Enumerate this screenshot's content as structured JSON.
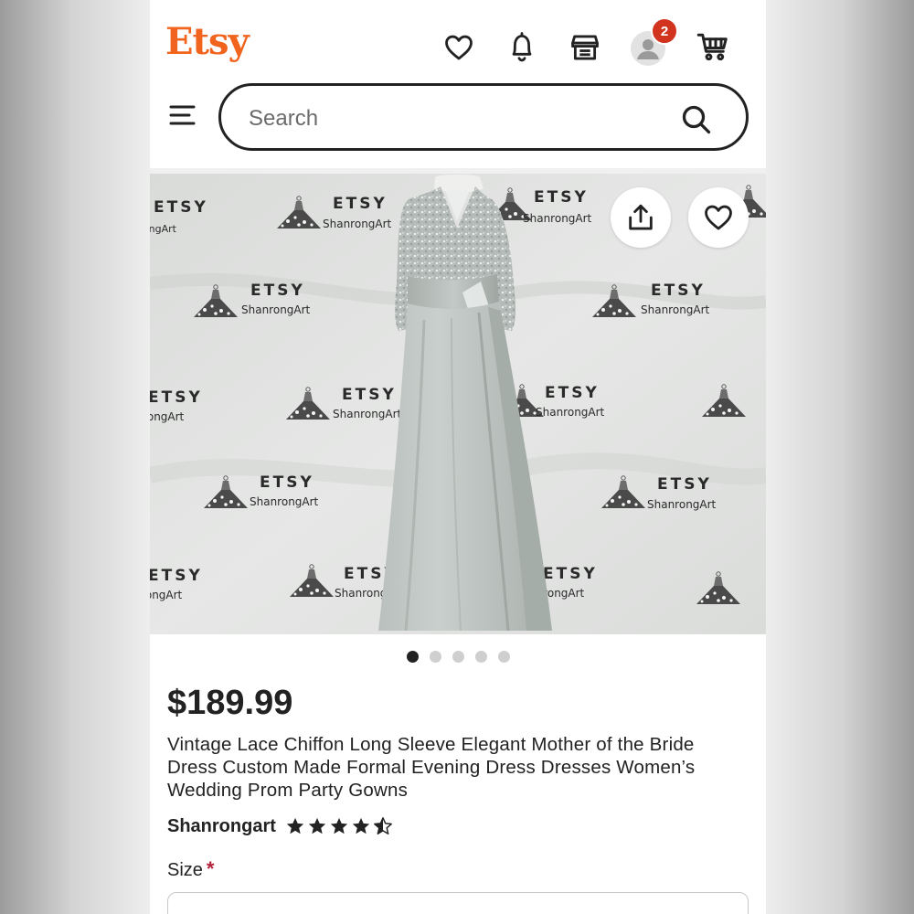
{
  "header": {
    "logo": "Etsy",
    "notification_badge": "2",
    "accent": "#f1641e",
    "badge_color": "#d2331e",
    "icons": [
      "heart-icon",
      "bell-icon",
      "shop-icon",
      "account-icon",
      "cart-icon"
    ]
  },
  "search": {
    "placeholder": "Search"
  },
  "gallery": {
    "watermark_brand": "ETSY",
    "watermark_shop": "ShanrongArt",
    "slide_count": 5,
    "active_slide": 1
  },
  "listing": {
    "price": "$189.99",
    "title": "Vintage Lace Chiffon Long Sleeve Elegant Mother of the Bride Dress Custom Made Formal Evening Dress Dresses Women’s Wedding Prom Party Gowns",
    "shop_name": "Shanrongart",
    "rating": 4.5,
    "rating_max": 5
  },
  "options": {
    "size_label": "Size",
    "required_mark": "*"
  }
}
